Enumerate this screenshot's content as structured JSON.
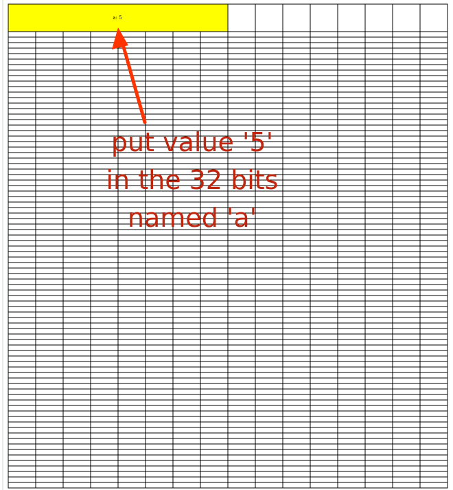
{
  "grid": {
    "highlight_cell": {
      "text": "a: 5",
      "fill_color": "#ffff00"
    },
    "line_color": "#000000"
  },
  "annotation": {
    "lines": [
      "put value '5'",
      "in the 32 bits",
      "named 'a'"
    ],
    "text_color": "#c0260e",
    "arrow_color": "#ff3300"
  }
}
